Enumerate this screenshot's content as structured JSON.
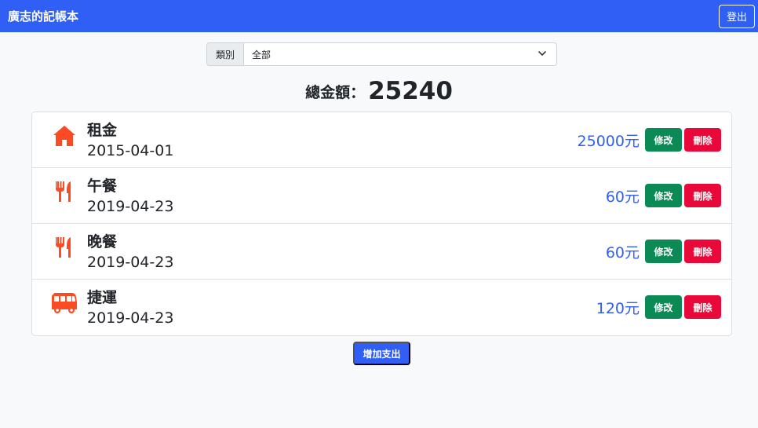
{
  "header": {
    "brand": "廣志的記帳本",
    "logout_label": "登出",
    "brand_color": "#2f5ff5"
  },
  "filter": {
    "label": "類別",
    "selected": "全部"
  },
  "summary": {
    "label": "總金額：",
    "value": "25240"
  },
  "expenses": [
    {
      "icon": "home-icon",
      "title": "租金",
      "date": "2015-04-01",
      "amount": "25000元",
      "edit_label": "修改",
      "delete_label": "刪除"
    },
    {
      "icon": "utensils-icon",
      "title": "午餐",
      "date": "2019-04-23",
      "amount": "60元",
      "edit_label": "修改",
      "delete_label": "刪除"
    },
    {
      "icon": "utensils-icon",
      "title": "晚餐",
      "date": "2019-04-23",
      "amount": "60元",
      "edit_label": "修改",
      "delete_label": "刪除"
    },
    {
      "icon": "bus-icon",
      "title": "捷運",
      "date": "2019-04-23",
      "amount": "120元",
      "edit_label": "修改",
      "delete_label": "刪除"
    }
  ],
  "add_button": {
    "label": "增加支出"
  },
  "colors": {
    "icon": "#fa4b25",
    "amount": "#2f5ff5",
    "edit": "#0c8a55",
    "delete": "#e8093a"
  }
}
